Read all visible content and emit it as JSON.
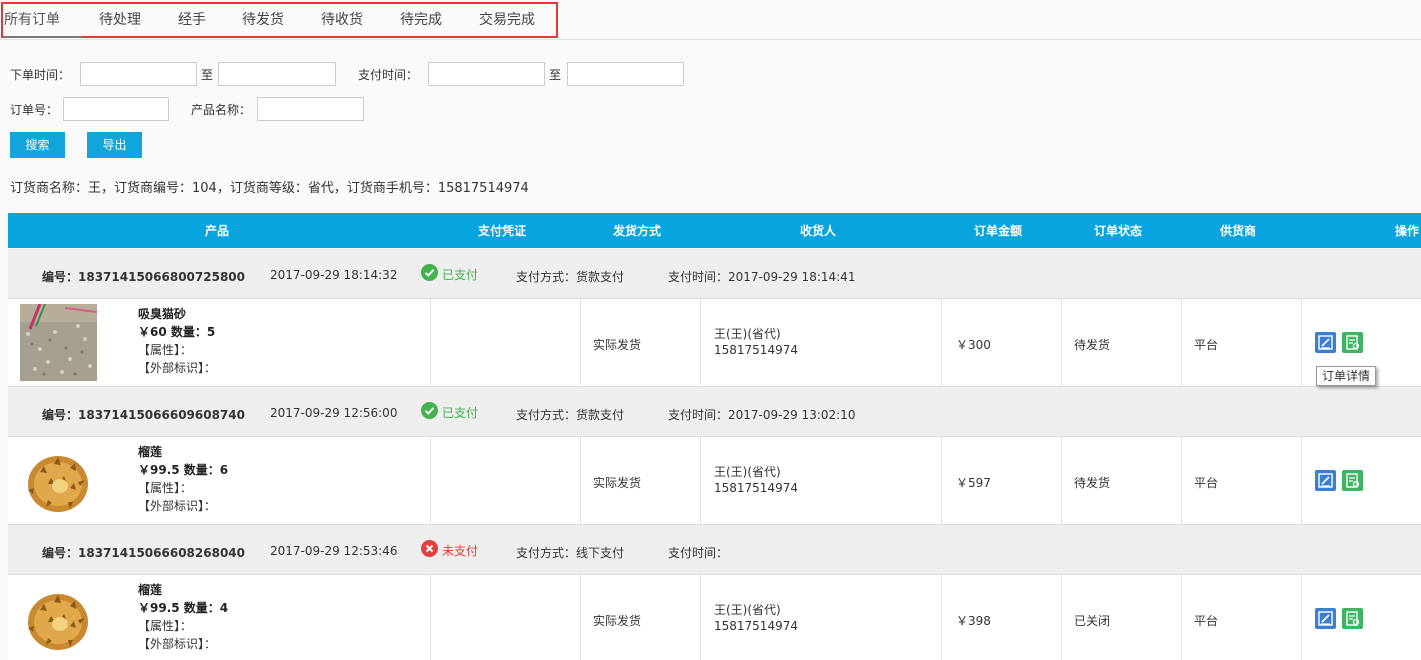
{
  "tabs": [
    {
      "label": "所有订单",
      "active": true
    },
    {
      "label": "待处理"
    },
    {
      "label": "经手"
    },
    {
      "label": "待发货"
    },
    {
      "label": "待收货"
    },
    {
      "label": "待完成"
    },
    {
      "label": "交易完成"
    }
  ],
  "filters": {
    "order_time_label": "下单时间：",
    "to_label": "至",
    "pay_time_label": "支付时间：",
    "order_no_label": "订单号：",
    "product_name_label": "产品名称：",
    "order_time_from": "",
    "order_time_to": "",
    "pay_time_from": "",
    "pay_time_to": "",
    "order_no": "",
    "product_name": ""
  },
  "buttons": {
    "search": "搜索",
    "export": "导出"
  },
  "dealer_info": "订货商名称：王，订货商编号：104，订货商等级：省代，订货商手机号：15817514974",
  "columns": [
    "产品",
    "支付凭证",
    "发货方式",
    "收货人",
    "订单金额",
    "订单状态",
    "供货商",
    "操作"
  ],
  "colors": {
    "header_bg": "#07a4dd",
    "paid": "#41b14f",
    "unpaid": "#e23a3a",
    "button": "#12a5d9"
  },
  "orders": [
    {
      "number": "编号：18371415066800725800",
      "order_time": "2017-09-29 18:14:32",
      "pay_status": "已支付",
      "paid": true,
      "pay_method": "支付方式：货款支付",
      "pay_time": "支付时间：2017-09-29 18:14:41",
      "product": {
        "name": "吸臭猫砂",
        "price_qty": "￥60 数量：5",
        "attr": "【属性】：",
        "ext": "【外部标识】：",
        "image": "cat-litter-image"
      },
      "ship_method": "实际发货",
      "receiver_name": "王(王)(省代)",
      "receiver_phone": "15817514974",
      "amount": "￥300",
      "status": "待发货",
      "supplier": "平台"
    },
    {
      "number": "编号：18371415066609608740",
      "order_time": "2017-09-29 12:56:00",
      "pay_status": "已支付",
      "paid": true,
      "pay_method": "支付方式：货款支付",
      "pay_time": "支付时间：2017-09-29 13:02:10",
      "product": {
        "name": "榴莲",
        "price_qty": "￥99.5 数量：6",
        "attr": "【属性】：",
        "ext": "【外部标识】：",
        "image": "durian-image"
      },
      "ship_method": "实际发货",
      "receiver_name": "王(王)(省代)",
      "receiver_phone": "15817514974",
      "amount": "￥597",
      "status": "待发货",
      "supplier": "平台"
    },
    {
      "number": "编号：18371415066608268040",
      "order_time": "2017-09-29 12:53:46",
      "pay_status": "未支付",
      "paid": false,
      "pay_method": "支付方式：线下支付",
      "pay_time": "支付时间：",
      "product": {
        "name": "榴莲",
        "price_qty": "￥99.5 数量：4",
        "attr": "【属性】：",
        "ext": "【外部标识】：",
        "image": "durian-image"
      },
      "ship_method": "实际发货",
      "receiver_name": "王(王)(省代)",
      "receiver_phone": "15817514974",
      "amount": "￥398",
      "status": "已关闭",
      "supplier": "平台"
    }
  ],
  "tooltip": "订单详情",
  "icons": {
    "paid": "check-circle-icon",
    "unpaid": "x-circle-icon",
    "edit": "edit-icon",
    "detail": "order-detail-icon"
  }
}
